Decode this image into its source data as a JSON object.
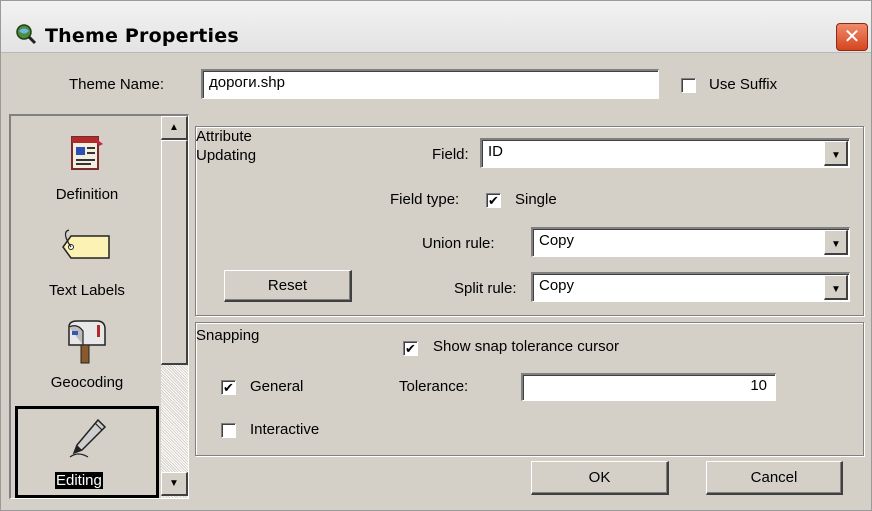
{
  "window": {
    "title": "Theme Properties",
    "close_glyph": "✕",
    "icons": {
      "title": "magnifier-globe-icon",
      "close": "close-icon"
    }
  },
  "theme_name": {
    "label": "Theme Name:",
    "value": "дороги.shp",
    "use_suffix_label": "Use Suffix",
    "use_suffix_checked": false
  },
  "nav": {
    "items": [
      {
        "label": "Definition",
        "icon": "definition-form-icon",
        "selected": false
      },
      {
        "label": "Text Labels",
        "icon": "tag-label-icon",
        "selected": false
      },
      {
        "label": "Geocoding",
        "icon": "mailbox-icon",
        "selected": false
      },
      {
        "label": "Editing",
        "icon": "pencil-icon",
        "selected": true
      }
    ],
    "scroll_up_glyph": "▲",
    "scroll_down_glyph": "▼"
  },
  "attribute_updating": {
    "group_label_line1": "Attribute",
    "group_label_line2": "Updating",
    "field_label": "Field:",
    "field_value": "ID",
    "field_type_label": "Field type:",
    "field_type_check": "✔",
    "field_type_value": "Single",
    "union_rule_label": "Union rule:",
    "union_rule_value": "Copy",
    "split_rule_label": "Split rule:",
    "split_rule_value": "Copy",
    "reset_label": "Reset",
    "dropdown_glyph": "▼"
  },
  "snapping": {
    "group_label": "Snapping",
    "show_cursor_label": "Show snap tolerance cursor",
    "show_cursor_checked": true,
    "general_label": "General",
    "general_checked": true,
    "interactive_label": "Interactive",
    "interactive_checked": false,
    "tolerance_label": "Tolerance:",
    "tolerance_value": "10",
    "check_glyph": "✔"
  },
  "footer": {
    "ok_label": "OK",
    "cancel_label": "Cancel"
  }
}
